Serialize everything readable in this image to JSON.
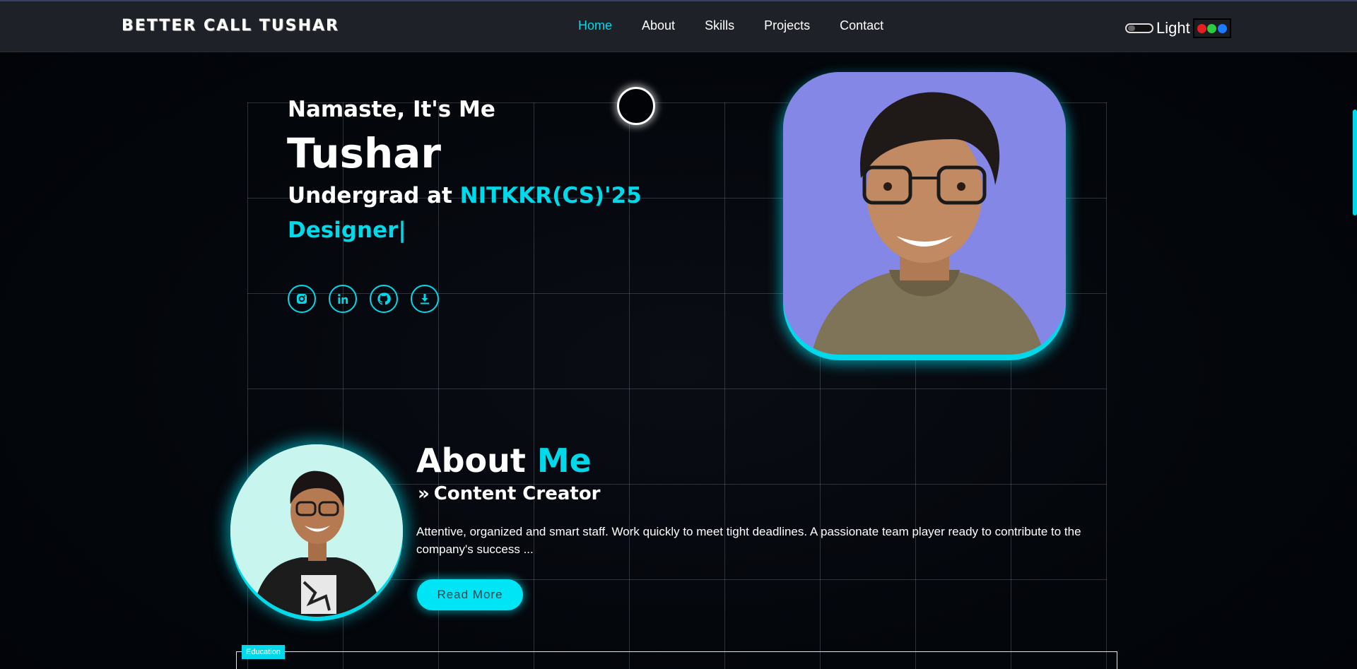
{
  "header": {
    "logo": "BETTER CALL TUSHAR",
    "nav": [
      "Home",
      "About",
      "Skills",
      "Projects",
      "Contact"
    ],
    "active_nav": "Home",
    "theme_label": "Light",
    "palette_colors": [
      "#e62020",
      "#2ecc40",
      "#1e7bff"
    ]
  },
  "hero": {
    "greeting": "Namaste, It's Me",
    "name": "Tushar",
    "role_prefix": "Undergrad at ",
    "role_highlight": "NITKKR(CS)'25",
    "typed_text": "Designer|",
    "socials": [
      "instagram-icon",
      "linkedin-icon",
      "github-icon",
      "download-icon"
    ]
  },
  "about": {
    "title_part1": "About ",
    "title_part2": "Me",
    "subtitle": "Content Creator",
    "description": "Attentive, organized and smart staff. Work quickly to meet tight deadlines. A passionate team player ready to contribute to the company's success ...",
    "button_label": "Read More"
  },
  "education": {
    "tag": "Education"
  },
  "colors": {
    "accent": "#00d9ea",
    "background": "#03060b",
    "header_bg": "#1f2128"
  }
}
